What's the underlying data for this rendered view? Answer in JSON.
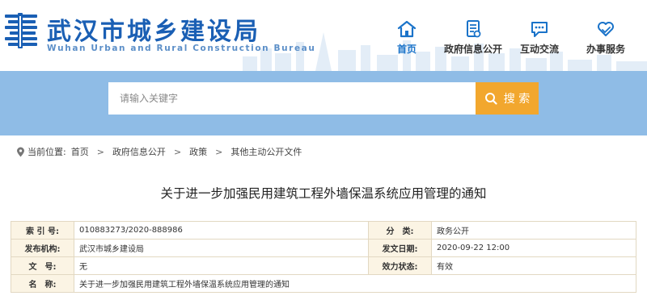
{
  "site": {
    "title": "武汉市城乡建设局",
    "subtitle": "Wuhan Urban and Rural Construction Bureau"
  },
  "nav": [
    {
      "label": "首页",
      "icon": "home-icon",
      "active": true
    },
    {
      "label": "政府信息公开",
      "icon": "document-icon",
      "active": false
    },
    {
      "label": "互动交流",
      "icon": "chat-icon",
      "active": false
    },
    {
      "label": "办事服务",
      "icon": "heart-hand-icon",
      "active": false
    }
  ],
  "search": {
    "placeholder": "请输入关键字",
    "button_label": "搜 索"
  },
  "breadcrumb": {
    "prefix": "当前位置:",
    "items": [
      "首页",
      "政府信息公开",
      "政策",
      "其他主动公开文件"
    ],
    "separator": ">"
  },
  "document": {
    "title": "关于进一步加强民用建筑工程外墙保温系统应用管理的通知"
  },
  "info": {
    "index_label": "索 引 号:",
    "index_value": "010883273/2020-888986",
    "category_label": "分　类:",
    "category_value": "政务公开",
    "issuer_label": "发布机构:",
    "issuer_value": "武汉市城乡建设局",
    "date_label": "发文日期:",
    "date_value": "2020-09-22 12:00",
    "docno_label": "文　号:",
    "docno_value": "无",
    "status_label": "效力状态:",
    "status_value": "有效",
    "name_label": "名　称:",
    "name_value": "关于进一步加强民用建筑工程外墙保温系统应用管理的通知"
  },
  "colors": {
    "brand_blue": "#1a5fb4",
    "search_band": "#8fbce6",
    "search_button": "#f2a72e",
    "table_label_bg": "#fbf4e4"
  }
}
